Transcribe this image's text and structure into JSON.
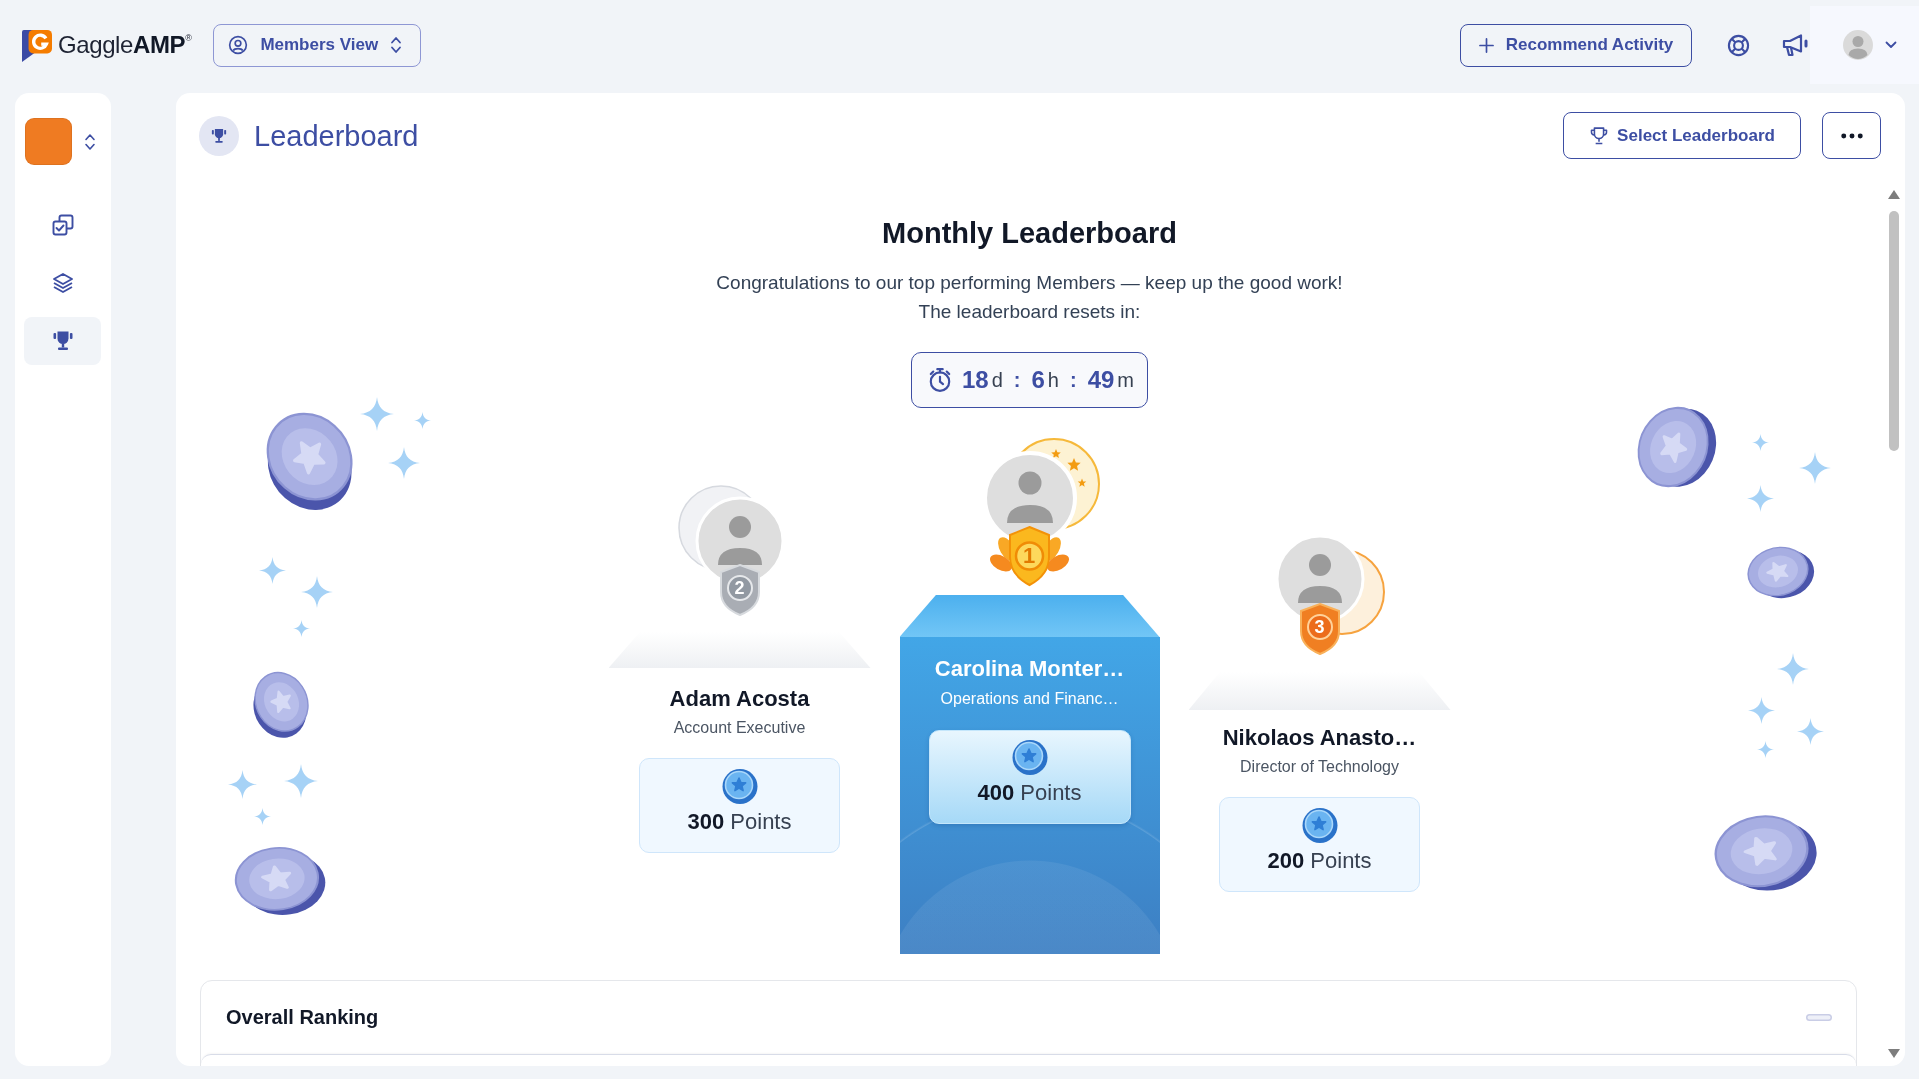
{
  "topbar": {
    "logo": "Gaggle**AMP**$^{®}$",
    "view_switcher": "Members View",
    "recommend_button": "Recommend Activity"
  },
  "sidebar": {
    "items": [
      {
        "selected": false
      },
      {
        "selected": false
      },
      {
        "selected": true
      }
    ]
  },
  "page": {
    "title": "Leaderboard",
    "select_button": "Select Leaderboard"
  },
  "hero": {
    "title": "Monthly Leaderboard",
    "subtitle": "Congratulations to our top performing Members — keep up the good work!",
    "reset_label": "The leaderboard resets in:",
    "countdown": [
      {
        "value": "18",
        "unit": "d",
        "separator": ":"
      },
      {
        "value": "6",
        "unit": "h",
        "separator": ":"
      },
      {
        "value": "49",
        "unit": "m"
      }
    ]
  },
  "podium": [
    {
      "kind": "second",
      "rank": "2",
      "name": "Adam Acosta",
      "role": "Account Executive",
      "points": "**300** Points"
    },
    {
      "kind": "first",
      "rank": "1",
      "name": "Carolina Monter…",
      "role": "Operations and Financ…",
      "points": "**400** Points"
    },
    {
      "kind": "third",
      "rank": "3",
      "name": "Nikolaos Anasto…",
      "role": "Director of Technology",
      "points": "**200** Points"
    }
  ],
  "overall_ranking": {
    "title": "Overall Ranking"
  }
}
